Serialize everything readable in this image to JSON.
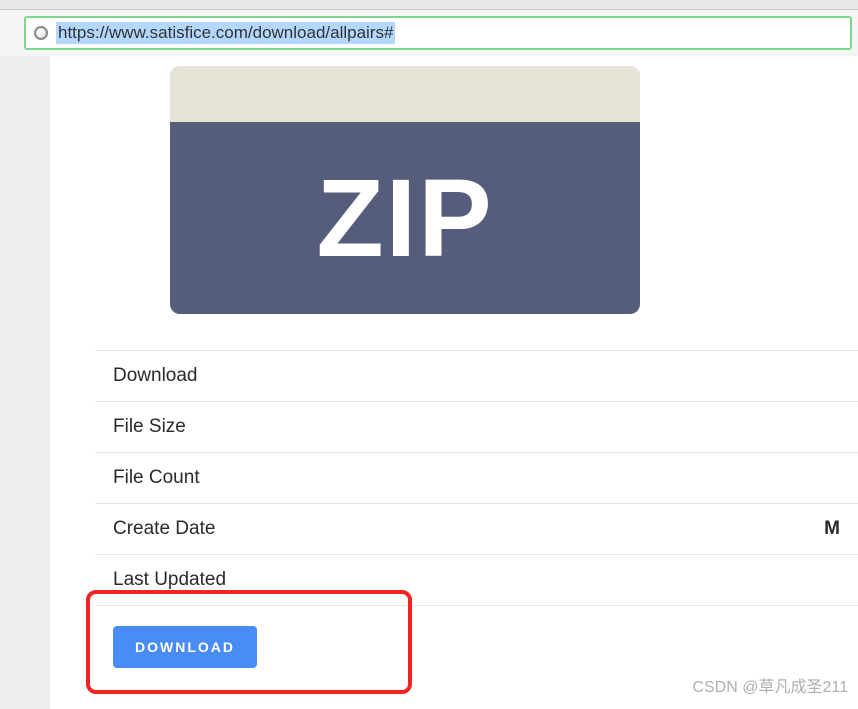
{
  "address_bar": {
    "url": "https://www.satisfice.com/download/allpairs#"
  },
  "zip_card": {
    "label": "ZIP"
  },
  "info_rows": {
    "download": "Download",
    "file_size": "File Size",
    "file_count": "File Count",
    "create_date": "Create Date",
    "create_date_value": "M",
    "last_updated": "Last Updated"
  },
  "buttons": {
    "download": "DOWNLOAD"
  },
  "watermark": "CSDN @草凡成圣211"
}
